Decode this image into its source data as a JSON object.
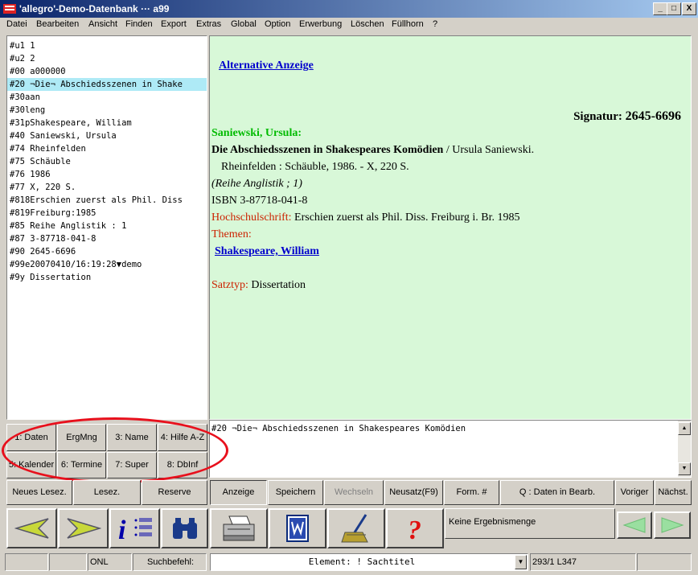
{
  "window": {
    "title": "'allegro'-Demo-Datenbank ··· a99",
    "min": "_",
    "max": "□",
    "close": "X"
  },
  "menu": [
    "Datei",
    "Bearbeiten",
    "Ansicht",
    "Finden",
    "Export",
    "Extras",
    "Global",
    "Option",
    "Erwerbung",
    "Löschen",
    "Füllhorn",
    "?"
  ],
  "record_lines": [
    "#u1 1",
    "#u2 2",
    "#00 a000000",
    "#20 ¬Die¬ Abschiedsszenen in Shake",
    "#30aan",
    "#30leng",
    "#31pShakespeare, William",
    "#40 Saniewski, Ursula",
    "#74 Rheinfelden",
    "#75 Schäuble",
    "#76 1986",
    "#77 X, 220 S.",
    "#818Erschien zuerst als Phil. Diss",
    "#819Freiburg:1985",
    "#85 Reihe Anglistik : 1",
    "#87 3-87718-041-8",
    "#90 2645-6696",
    "#99e20070410/16:19:28▼demo",
    "#9y Dissertation"
  ],
  "display": {
    "alt_link": "Alternative Anzeige",
    "signatur_label": "Signatur:",
    "signatur_value": "2645-6696",
    "author": "Saniewski, Ursula:",
    "title_bold": "Die Abschiedsszenen in Shakespeares Komödien",
    "title_rest": " / Ursula Saniewski.",
    "imprint": "Rheinfelden : Schäuble, 1986. - X, 220 S.",
    "series": "(Reihe Anglistik ; 1)",
    "isbn": "ISBN 3-87718-041-8",
    "thesis_label": "Hochschulschrift:",
    "thesis_value": " Erschien zuerst als Phil. Diss. Freiburg i. Br. 1985",
    "themen_label": "Themen:",
    "themen_link": "Shakespeare, William",
    "satztyp_label": "Satztyp:",
    "satztyp_value": " Dissertation"
  },
  "editor": {
    "text": "#20 ¬Die¬ Abschiedsszenen in Shakespeares Komödien",
    "up": "▲",
    "down": "▼"
  },
  "index_buttons": [
    "1: Daten",
    "ErgMng",
    "3: Name",
    "4: Hilfe A-Z",
    "5: Kalender",
    "6: Termine",
    "7: Super",
    "8: DbInf"
  ],
  "left_buttons": [
    "Neues Lesez.",
    "Lesez.",
    "Reserve"
  ],
  "action_buttons": [
    "Anzeige",
    "Speichern",
    "Wechseln",
    "Neusatz(F9)",
    "Form. #",
    "Q : Daten in Bearb.",
    "Voriger",
    "Nächst."
  ],
  "toolbar": {
    "result_text": "Keine Ergebnismenge",
    "info_glyph": "i",
    "help_glyph": "?"
  },
  "statusbar": {
    "onl": "ONL",
    "search_label": "Suchbefehl:",
    "element": "Element: ! Sachtitel",
    "position": "293/1 L347",
    "dropdown": "▼"
  }
}
